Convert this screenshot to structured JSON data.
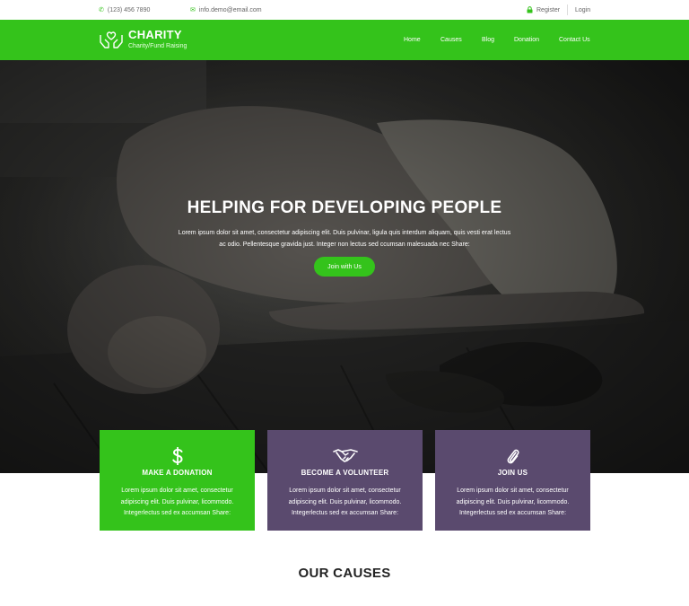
{
  "topbar": {
    "phone": "(123) 456 7890",
    "email": "info.demo@email.com",
    "register": "Register",
    "login": "Login"
  },
  "brand": {
    "name": "CHARITY",
    "tagline": "Charity/Fund Raising"
  },
  "nav": {
    "home": "Home",
    "causes": "Causes",
    "blog": "Blog",
    "donation": "Donation",
    "contact": "Contact Us"
  },
  "hero": {
    "title": "HELPING FOR DEVELOPING PEOPLE",
    "text": "Lorem ipsum dolor sit amet, consectetur adipiscing elit. Duis pulvinar, ligula quis interdum aliquam, quis vesti erat lectus ac odio. Pellentesque gravida just. Integer non lectus sed ccumsan malesuada nec Share:",
    "button": "Join with Us"
  },
  "cards": [
    {
      "title": "MAKE A DONATION",
      "text": "Lorem ipsum dolor sit amet, consectetur adipiscing elit. Duis pulvinar, licommodo. Integerlectus sed ex accumsan Share:",
      "icon": "dollar-icon"
    },
    {
      "title": "BECOME A VOLUNTEER",
      "text": "Lorem ipsum dolor sit amet, consectetur adipiscing elit. Duis pulvinar, licommodo. Integerlectus sed ex accumsan Share:",
      "icon": "handshake-icon"
    },
    {
      "title": "JOIN US",
      "text": "Lorem ipsum dolor sit amet, consectetur adipiscing elit. Duis pulvinar, licommodo. Integerlectus sed ex accumsan Share:",
      "icon": "paperclip-icon"
    }
  ],
  "causes": {
    "title": "OUR CAUSES"
  },
  "colors": {
    "brand_green": "#34c31b",
    "card_purple": "#5a4a6e"
  }
}
